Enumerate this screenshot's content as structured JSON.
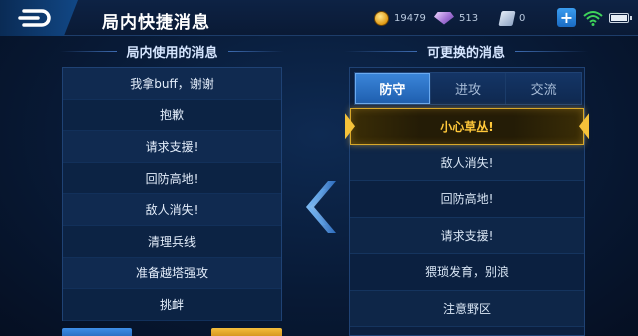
{
  "header": {
    "title": "局内快捷消息",
    "back_icon": "back-arrow-icon",
    "gold": "19479",
    "gems": "513",
    "tickets": "0",
    "plus_label": "+"
  },
  "left_panel": {
    "title": "局内使用的消息",
    "items": [
      {
        "label": "我拿buff，谢谢"
      },
      {
        "label": "抱歉"
      },
      {
        "label": "请求支援!"
      },
      {
        "label": "回防高地!"
      },
      {
        "label": "敌人消失!"
      },
      {
        "label": "清理兵线"
      },
      {
        "label": "准备越塔强攻"
      },
      {
        "label": "挑衅"
      }
    ]
  },
  "right_panel": {
    "title": "可更换的消息",
    "tabs": [
      {
        "label": "防守",
        "active": true
      },
      {
        "label": "进攻",
        "active": false
      },
      {
        "label": "交流",
        "active": false
      }
    ],
    "items": [
      {
        "label": "小心草丛!",
        "selected": true
      },
      {
        "label": "敌人消失!"
      },
      {
        "label": "回防高地!"
      },
      {
        "label": "请求支援!"
      },
      {
        "label": "猥琐发育，别浪"
      },
      {
        "label": "注意野区"
      }
    ]
  },
  "colors": {
    "accent_blue": "#2f7fd8",
    "highlight_gold": "#ffc83a",
    "panel_bg": "#0d2447"
  }
}
